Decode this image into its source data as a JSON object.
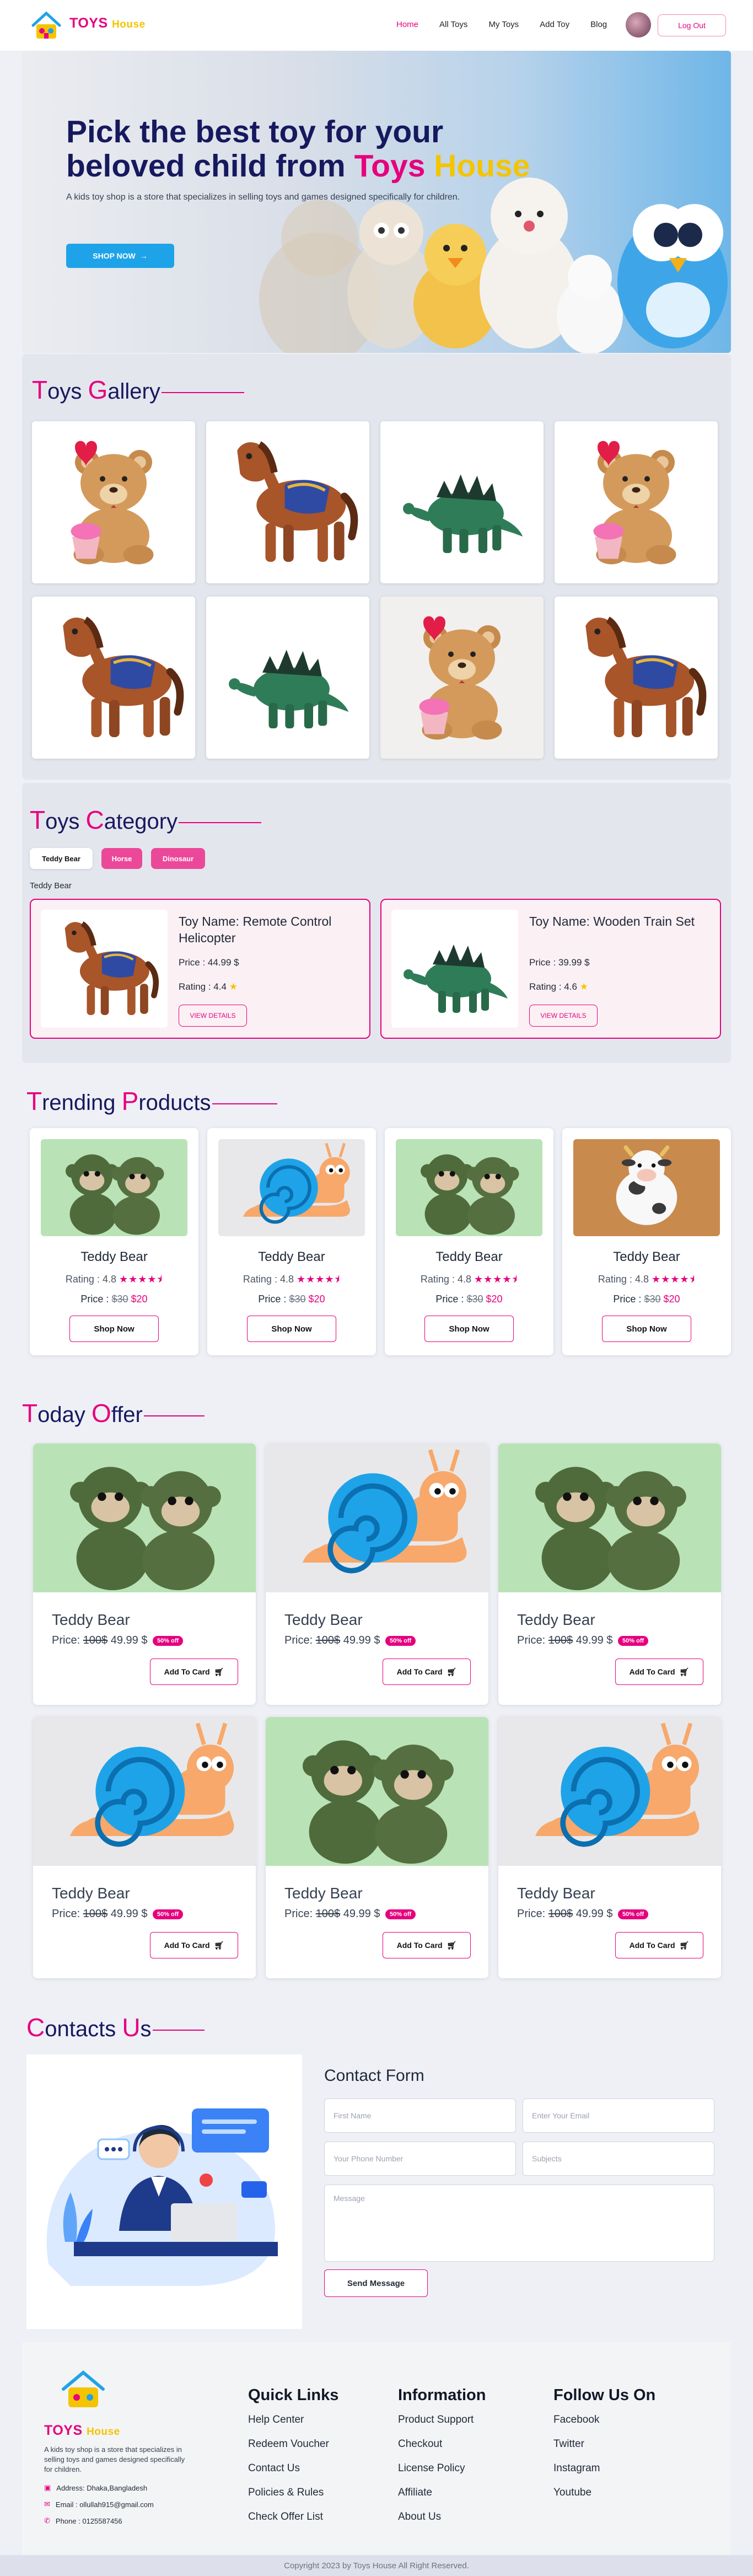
{
  "nav": {
    "brand_first": "TOYS",
    "brand_second": "House",
    "links": [
      "Home",
      "All Toys",
      "My Toys",
      "Add Toy",
      "Blog"
    ],
    "logout": "Log Out"
  },
  "hero": {
    "title_line1": "Pick the best toy for your",
    "title_line2": "beloved child from",
    "title_accent1": "Toys",
    "title_accent2": "House",
    "description": "A kids toy shop is a store that specializes in selling toys and games designed specifically for children.",
    "cta": "SHOP NOW"
  },
  "gallery": {
    "title_first_letter": "T",
    "title_rest1": "oys ",
    "title_second_letter": "G",
    "title_rest2": "allery"
  },
  "category": {
    "title_first_letter": "T",
    "title_rest1": "oys ",
    "title_second_letter": "C",
    "title_rest2": "ategory",
    "tabs": [
      "Teddy Bear",
      "Horse",
      "Dinosaur"
    ],
    "active_label": "Teddy Bear",
    "cards": [
      {
        "name": "Toy Name: Remote Control Helicopter",
        "price": "Price : 44.99 $",
        "rating": "Rating : 4.4",
        "button": "VIEW DETAILS"
      },
      {
        "name": "Toy Name: Wooden Train Set",
        "price": "Price : 39.99 $",
        "rating": "Rating : 4.6",
        "button": "VIEW DETAILS"
      }
    ]
  },
  "trending": {
    "title_first_letter": "T",
    "title_rest1": "rending ",
    "title_second_letter": "P",
    "title_rest2": "roducts",
    "rating_label": "Rating : 4.8",
    "price_label": "Price :",
    "old_price": "$30",
    "new_price": "$20",
    "button": "Shop Now",
    "items": [
      {
        "name": "Teddy Bear"
      },
      {
        "name": "Teddy Bear"
      },
      {
        "name": "Teddy Bear"
      },
      {
        "name": "Teddy Bear"
      }
    ]
  },
  "offer": {
    "title_first_letter": "T",
    "title_rest1": "oday ",
    "title_second_letter": "O",
    "title_rest2": "ffer",
    "name": "Teddy Bear",
    "price_label": "Price:",
    "old_price": "100$",
    "new_price": "49.99 $",
    "badge": "50% off",
    "button": "Add To Card"
  },
  "contact": {
    "title_first_letter": "C",
    "title_rest1": "ontacts ",
    "title_second_letter": "U",
    "title_rest2": "s",
    "form_title": "Contact Form",
    "first_name": "First Name",
    "email": "Enter Your Email",
    "phone": "Your Phone Number",
    "subjects": "Subjects",
    "message": "Message",
    "send": "Send Message"
  },
  "footer": {
    "brand_first": "TOYS",
    "brand_second": "House",
    "about": "A kids toy shop is a store that specializes in selling toys and games designed specifically for children.",
    "address": "Address: Dhaka,Bangladesh",
    "email": "Email : ollullah915@gmail.com",
    "phone": "Phone : 0125587456",
    "quick_links_title": "Quick Links",
    "quick_links": [
      "Help Center",
      "Redeem Voucher",
      "Contact Us",
      "Policies & Rules",
      "Check Offer List"
    ],
    "information_title": "Information",
    "information": [
      "Product Support",
      "Checkout",
      "License Policy",
      "Affiliate",
      "About Us"
    ],
    "follow_title": "Follow Us On",
    "follow": [
      "Facebook",
      "Twitter",
      "Instagram",
      "Youtube"
    ],
    "copyright": "Copyright 2023 by Toys House All Right Reserved."
  },
  "colors": {
    "accent": "#e6007e",
    "brand_yellow": "#f5c400",
    "navy": "#16195e",
    "cta_blue": "#1fa3e8"
  }
}
